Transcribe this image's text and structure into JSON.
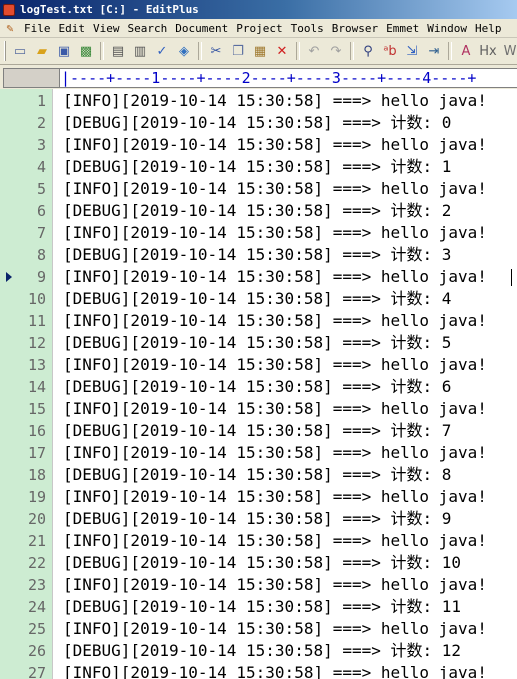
{
  "window": {
    "title": "logTest.txt [C:] - EditPlus"
  },
  "menubar": {
    "items": [
      "File",
      "Edit",
      "View",
      "Search",
      "Document",
      "Project",
      "Tools",
      "Browser",
      "Emmet",
      "Window",
      "Help"
    ]
  },
  "toolbar": {
    "buttons": [
      {
        "name": "new-file-icon",
        "glyph": "▭",
        "color": "#5a6ea0"
      },
      {
        "name": "open-folder-icon",
        "glyph": "▰",
        "color": "#d9a21b"
      },
      {
        "name": "save-icon",
        "glyph": "▣",
        "color": "#3b5aa8"
      },
      {
        "name": "save-all-icon",
        "glyph": "▩",
        "color": "#3c8a3c"
      },
      {
        "sep": true
      },
      {
        "name": "print-preview-icon",
        "glyph": "▤",
        "color": "#555555"
      },
      {
        "name": "print-icon",
        "glyph": "▥",
        "color": "#555555"
      },
      {
        "name": "spell-check-icon",
        "glyph": "✓",
        "color": "#3060c0"
      },
      {
        "name": "browser-preview-icon",
        "glyph": "◈",
        "color": "#3070c0"
      },
      {
        "sep": true
      },
      {
        "name": "cut-icon",
        "glyph": "✂",
        "color": "#3050a0"
      },
      {
        "name": "copy-icon",
        "glyph": "❐",
        "color": "#5a6ea0"
      },
      {
        "name": "paste-icon",
        "glyph": "▦",
        "color": "#a07a30"
      },
      {
        "name": "delete-icon",
        "glyph": "✕",
        "color": "#d02020"
      },
      {
        "sep": true
      },
      {
        "name": "undo-icon",
        "glyph": "↶",
        "color": "#a0a0a0"
      },
      {
        "name": "redo-icon",
        "glyph": "↷",
        "color": "#a0a0a0"
      },
      {
        "sep": true
      },
      {
        "name": "find-icon",
        "glyph": "⚲",
        "color": "#304080"
      },
      {
        "name": "replace-icon",
        "glyph": "ᵃb",
        "color": "#c03030"
      },
      {
        "name": "goto-icon",
        "glyph": "⇲",
        "color": "#3060c0"
      },
      {
        "name": "indent-icon",
        "glyph": "⇥",
        "color": "#306090"
      },
      {
        "sep": true
      },
      {
        "name": "font-icon",
        "glyph": "A",
        "color": "#b03060"
      },
      {
        "name": "html-toolbar-icon",
        "glyph": "Hx",
        "color": "#606060"
      },
      {
        "name": "word-wrap-icon",
        "glyph": "W",
        "color": "#707070"
      },
      {
        "name": "more-icon",
        "glyph": "≡",
        "color": "#3c7a3c"
      }
    ]
  },
  "ruler": {
    "text": "|----+----1----+----2----+----3----+----4----+"
  },
  "editor": {
    "current_line": 9,
    "lines": [
      {
        "n": "1",
        "text": "[INFO][2019-10-14 15:30:58] ===> hello java!"
      },
      {
        "n": "2",
        "text": "[DEBUG][2019-10-14 15:30:58] ===> 计数: 0"
      },
      {
        "n": "3",
        "text": "[INFO][2019-10-14 15:30:58] ===> hello java!"
      },
      {
        "n": "4",
        "text": "[DEBUG][2019-10-14 15:30:58] ===> 计数: 1"
      },
      {
        "n": "5",
        "text": "[INFO][2019-10-14 15:30:58] ===> hello java!"
      },
      {
        "n": "6",
        "text": "[DEBUG][2019-10-14 15:30:58] ===> 计数: 2"
      },
      {
        "n": "7",
        "text": "[INFO][2019-10-14 15:30:58] ===> hello java!"
      },
      {
        "n": "8",
        "text": "[DEBUG][2019-10-14 15:30:58] ===> 计数: 3"
      },
      {
        "n": "9",
        "text": "[INFO][2019-10-14 15:30:58] ===> hello java!"
      },
      {
        "n": "10",
        "text": "[DEBUG][2019-10-14 15:30:58] ===> 计数: 4"
      },
      {
        "n": "11",
        "text": "[INFO][2019-10-14 15:30:58] ===> hello java!"
      },
      {
        "n": "12",
        "text": "[DEBUG][2019-10-14 15:30:58] ===> 计数: 5"
      },
      {
        "n": "13",
        "text": "[INFO][2019-10-14 15:30:58] ===> hello java!"
      },
      {
        "n": "14",
        "text": "[DEBUG][2019-10-14 15:30:58] ===> 计数: 6"
      },
      {
        "n": "15",
        "text": "[INFO][2019-10-14 15:30:58] ===> hello java!"
      },
      {
        "n": "16",
        "text": "[DEBUG][2019-10-14 15:30:58] ===> 计数: 7"
      },
      {
        "n": "17",
        "text": "[INFO][2019-10-14 15:30:58] ===> hello java!"
      },
      {
        "n": "18",
        "text": "[DEBUG][2019-10-14 15:30:58] ===> 计数: 8"
      },
      {
        "n": "19",
        "text": "[INFO][2019-10-14 15:30:58] ===> hello java!"
      },
      {
        "n": "20",
        "text": "[DEBUG][2019-10-14 15:30:58] ===> 计数: 9"
      },
      {
        "n": "21",
        "text": "[INFO][2019-10-14 15:30:58] ===> hello java!"
      },
      {
        "n": "22",
        "text": "[DEBUG][2019-10-14 15:30:58] ===> 计数: 10"
      },
      {
        "n": "23",
        "text": "[INFO][2019-10-14 15:30:58] ===> hello java!"
      },
      {
        "n": "24",
        "text": "[DEBUG][2019-10-14 15:30:58] ===> 计数: 11"
      },
      {
        "n": "25",
        "text": "[INFO][2019-10-14 15:30:58] ===> hello java!"
      },
      {
        "n": "26",
        "text": "[DEBUG][2019-10-14 15:30:58] ===> 计数: 12"
      },
      {
        "n": "27",
        "text": "[INFO][2019-10-14 15:30:58] ===> hello java!"
      }
    ]
  }
}
